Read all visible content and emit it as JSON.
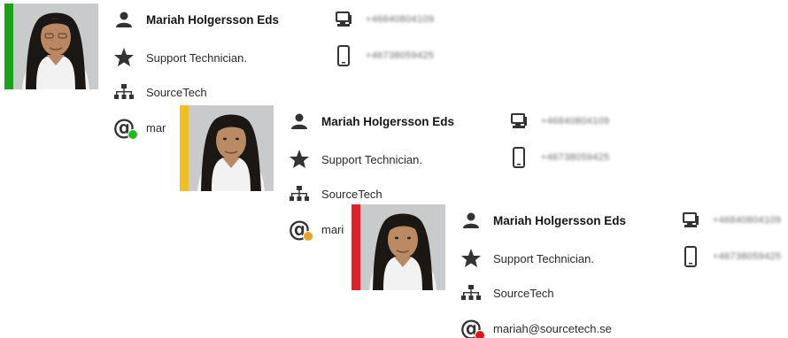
{
  "cards": [
    {
      "status_color": "#1aa31a",
      "name": "Mariah Holgersson Eds",
      "title": "Support Technician.",
      "organization": "SourceTech",
      "email": "mar",
      "presence_color": "#25b825",
      "desk_phone": "+46840804109",
      "mobile_phone": "+46738059425",
      "icons": {
        "person": "person-icon",
        "title": "star-icon",
        "organization": "org-chart-icon",
        "email": "at-icon",
        "desk": "desk-phone-icon",
        "mobile": "mobile-phone-icon"
      }
    },
    {
      "status_color": "#f0c020",
      "name": "Mariah Holgersson Eds",
      "title": "Support Technician.",
      "organization": "SourceTech",
      "email": "mari",
      "presence_color": "#f0a020",
      "desk_phone": "+46840804109",
      "mobile_phone": "+46738059425",
      "icons": {
        "person": "person-icon",
        "title": "star-icon",
        "organization": "org-chart-icon",
        "email": "at-icon",
        "desk": "desk-phone-icon",
        "mobile": "mobile-phone-icon"
      }
    },
    {
      "status_color": "#e0202a",
      "name": "Mariah Holgersson Eds",
      "title": "Support Technician.",
      "organization": "SourceTech",
      "email": "mariah@sourcetech.se",
      "presence_color": "#e01818",
      "desk_phone": "+46840804109",
      "mobile_phone": "+46738059425",
      "icons": {
        "person": "person-icon",
        "title": "star-icon",
        "organization": "org-chart-icon",
        "email": "at-icon",
        "desk": "desk-phone-icon",
        "mobile": "mobile-phone-icon"
      }
    }
  ]
}
